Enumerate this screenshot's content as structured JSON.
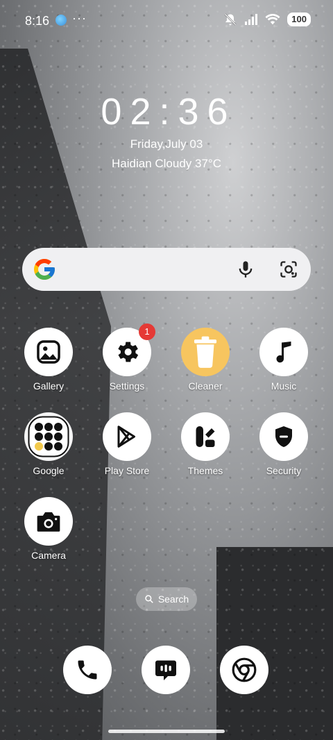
{
  "status_bar": {
    "time": "8:16",
    "more": "···",
    "battery": "100"
  },
  "clock": {
    "time": "02:36",
    "date": "Friday,July 03",
    "weather": "Haidian Cloudy 37°C"
  },
  "search": {
    "mic_icon": "mic-icon",
    "lens_icon": "camera-lens-icon"
  },
  "apps": [
    {
      "label": "Gallery"
    },
    {
      "label": "Settings",
      "badge": "1"
    },
    {
      "label": "Cleaner"
    },
    {
      "label": "Music"
    },
    {
      "label": "Google"
    },
    {
      "label": "Play Store"
    },
    {
      "label": "Themes"
    },
    {
      "label": "Security"
    },
    {
      "label": "Camera"
    }
  ],
  "search_pill": {
    "label": "Search"
  },
  "dock": [
    "phone-icon",
    "messages-icon",
    "chrome-icon"
  ]
}
